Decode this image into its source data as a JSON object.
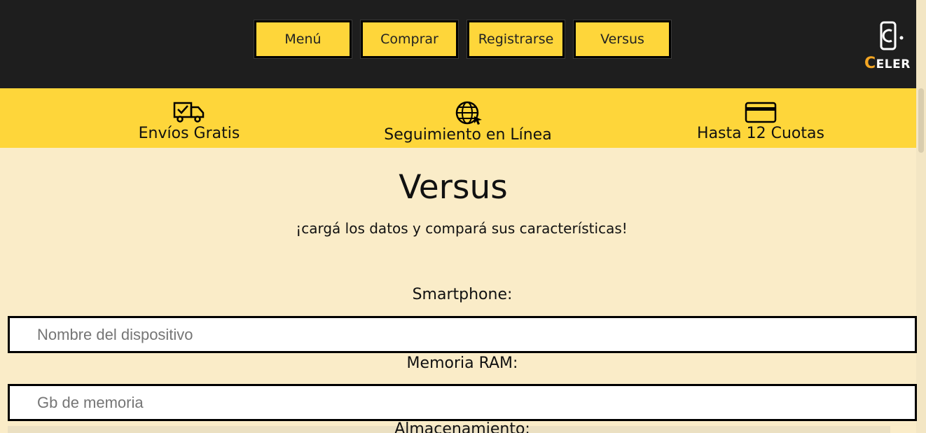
{
  "nav": {
    "items": [
      {
        "label": "Menú"
      },
      {
        "label": "Comprar"
      },
      {
        "label": "Registrarse"
      },
      {
        "label": "Versus"
      }
    ]
  },
  "logo": {
    "first_letter": "C",
    "rest": "ELER"
  },
  "features": [
    {
      "icon": "delivery-truck-icon",
      "label": "Envíos Gratis"
    },
    {
      "icon": "globe-tracking-icon",
      "label": "Seguimiento en Línea"
    },
    {
      "icon": "credit-card-icon",
      "label": "Hasta 12 Cuotas"
    }
  ],
  "main": {
    "title": "Versus",
    "subtitle": "¡cargá los datos y compará sus características!",
    "fields": [
      {
        "label": "Smartphone:",
        "placeholder": "Nombre del dispositivo",
        "value": ""
      },
      {
        "label": "Memoria RAM:",
        "placeholder": "Gb de memoria",
        "value": ""
      },
      {
        "label": "Almacenamiento:"
      }
    ]
  },
  "colors": {
    "header_bg": "#1e1e1e",
    "accent_yellow": "#fed63a",
    "page_bg": "#faecc8",
    "logo_accent": "#f4a623"
  }
}
